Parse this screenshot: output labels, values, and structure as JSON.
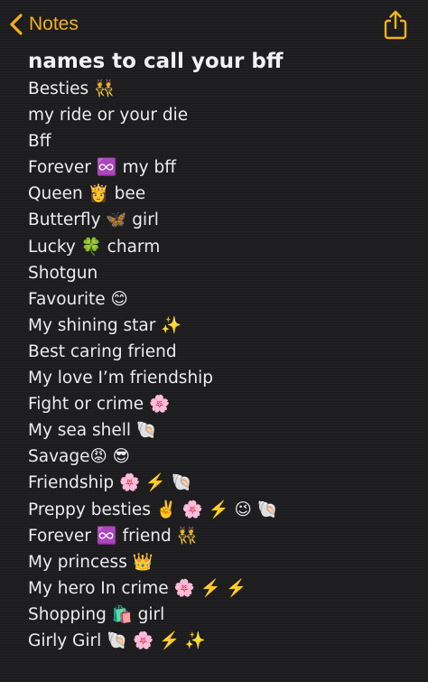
{
  "nav": {
    "back_label": "Notes",
    "back_icon": "chevron-left-icon",
    "share_icon": "share-icon",
    "accent": "#f3b21a"
  },
  "note": {
    "title": "names to call your bff",
    "lines": [
      "Besties 👯",
      "my ride or your die",
      "Bff",
      "Forever ♾️ my bff",
      "Queen 👸 bee",
      "Butterfly 🦋 girl",
      "Lucky 🍀 charm",
      "Shotgun",
      "Favourite 😊",
      "My shining star ✨",
      "Best caring friend",
      "My love I’m friendship",
      "Fight or crime 🌸",
      "My sea shell 🐚",
      "Savage😡 😎",
      "Friendship 🌸 ⚡️ 🐚",
      "Preppy besties ✌️ 🌸 ⚡️ 😉 🐚",
      "Forever ♾️ friend 👯",
      "My princess 👑",
      "My hero In crime 🌸 ⚡️ ⚡️",
      "Shopping 🛍️ girl",
      "Girly Girl 🐚 🌸 ⚡️ ✨"
    ]
  }
}
